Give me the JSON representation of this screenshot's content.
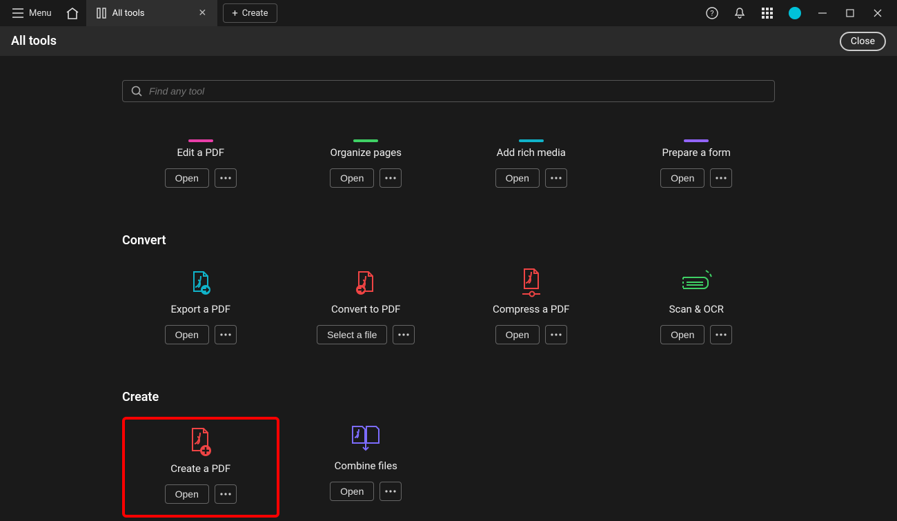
{
  "titleBar": {
    "menuLabel": "Menu",
    "tabLabel": "All tools",
    "createLabel": "Create"
  },
  "subBar": {
    "title": "All tools",
    "closeLabel": "Close"
  },
  "search": {
    "placeholder": "Find any tool"
  },
  "partialSection": {
    "cards": [
      {
        "label": "Edit a PDF",
        "primary": "Open",
        "color": "#e83ea8"
      },
      {
        "label": "Organize pages",
        "primary": "Open",
        "color": "#3fd165"
      },
      {
        "label": "Add rich media",
        "primary": "Open",
        "color": "#10b3c9"
      },
      {
        "label": "Prepare a form",
        "primary": "Open",
        "color": "#9265ff"
      }
    ]
  },
  "sections": [
    {
      "title": "Convert",
      "cards": [
        {
          "label": "Export a PDF",
          "primary": "Open",
          "icon": "export-pdf",
          "color": "#10b3c9"
        },
        {
          "label": "Convert to PDF",
          "primary": "Select a file",
          "icon": "convert-pdf",
          "color": "#ef4444"
        },
        {
          "label": "Compress a PDF",
          "primary": "Open",
          "icon": "compress-pdf",
          "color": "#ef4444"
        },
        {
          "label": "Scan & OCR",
          "primary": "Open",
          "icon": "scan-ocr",
          "color": "#3fd165"
        }
      ]
    },
    {
      "title": "Create",
      "cards": [
        {
          "label": "Create a PDF",
          "primary": "Open",
          "icon": "create-pdf",
          "color": "#ef4444",
          "highlight": true
        },
        {
          "label": "Combine files",
          "primary": "Open",
          "icon": "combine-files",
          "color": "#7c6cff"
        }
      ]
    }
  ]
}
